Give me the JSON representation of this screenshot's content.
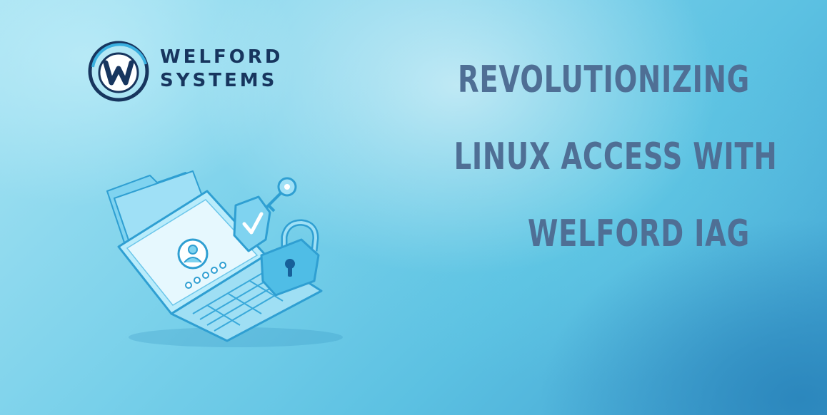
{
  "brand": {
    "line1": "WELFORD",
    "line2": "SYSTEMS",
    "mark_icon": "w-circle-logo-icon",
    "color": "#17355e"
  },
  "headline": {
    "lines": [
      "REVOLUTIONIZING",
      "LINUX ACCESS WITH",
      "WELFORD IAG"
    ],
    "color": "#4f6f95"
  },
  "illustration": {
    "icons": [
      "laptop-icon",
      "folder-icon",
      "user-avatar-icon",
      "password-dots-icon",
      "shield-check-icon",
      "key-icon",
      "padlock-icon",
      "keyboard-icon"
    ],
    "accent": "#3ab0e0"
  }
}
